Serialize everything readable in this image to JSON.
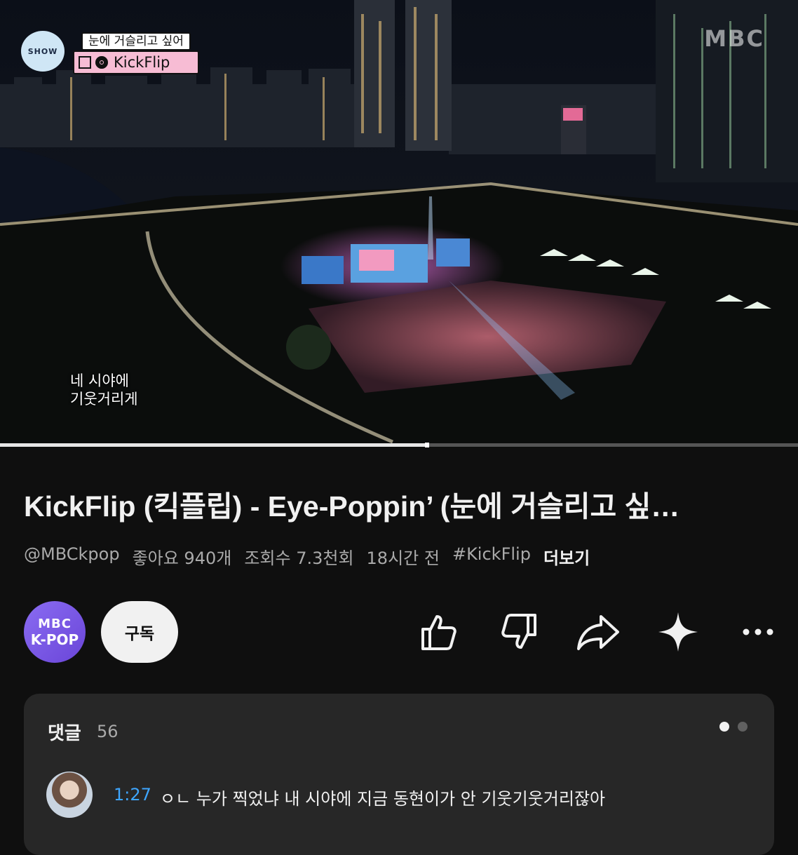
{
  "video": {
    "program_badge": {
      "logo_text": "SHOW",
      "song": "눈에 거슬리고 싶어",
      "artist": "KickFlip"
    },
    "watermark": "MBC",
    "subtitle": [
      "네 시야에",
      "기웃거리게"
    ],
    "progress": 0.535
  },
  "info": {
    "title": "KickFlip (킥플립) - Eye-Poppin’ (눈에 거슬리고 싶…",
    "channel_handle": "@MBCkpop",
    "likes": "좋아요 940개",
    "views": "조회수 7.3천회",
    "posted": "18시간 전",
    "hashtag": "#KickFlip",
    "more": "더보기"
  },
  "channel": {
    "avatar_line1": "MBC",
    "avatar_line2": "K-POP",
    "subscribe_label": "구독"
  },
  "actions": [
    "like-icon",
    "dislike-icon",
    "share-icon",
    "sparkle-icon",
    "more-icon"
  ],
  "comments": {
    "header": "댓글",
    "count": "56",
    "top_comment": {
      "timestamp": "1:27",
      "text": "ㅇㄴ 누가 찍었냐 내 시야에 지금 동현이가 안 기웃기웃거리잖아"
    }
  },
  "colors": {
    "background": "#0f0f0f",
    "panel": "#272727",
    "accent_link": "#3ea6ff",
    "avatar": "#7b5ae8"
  }
}
